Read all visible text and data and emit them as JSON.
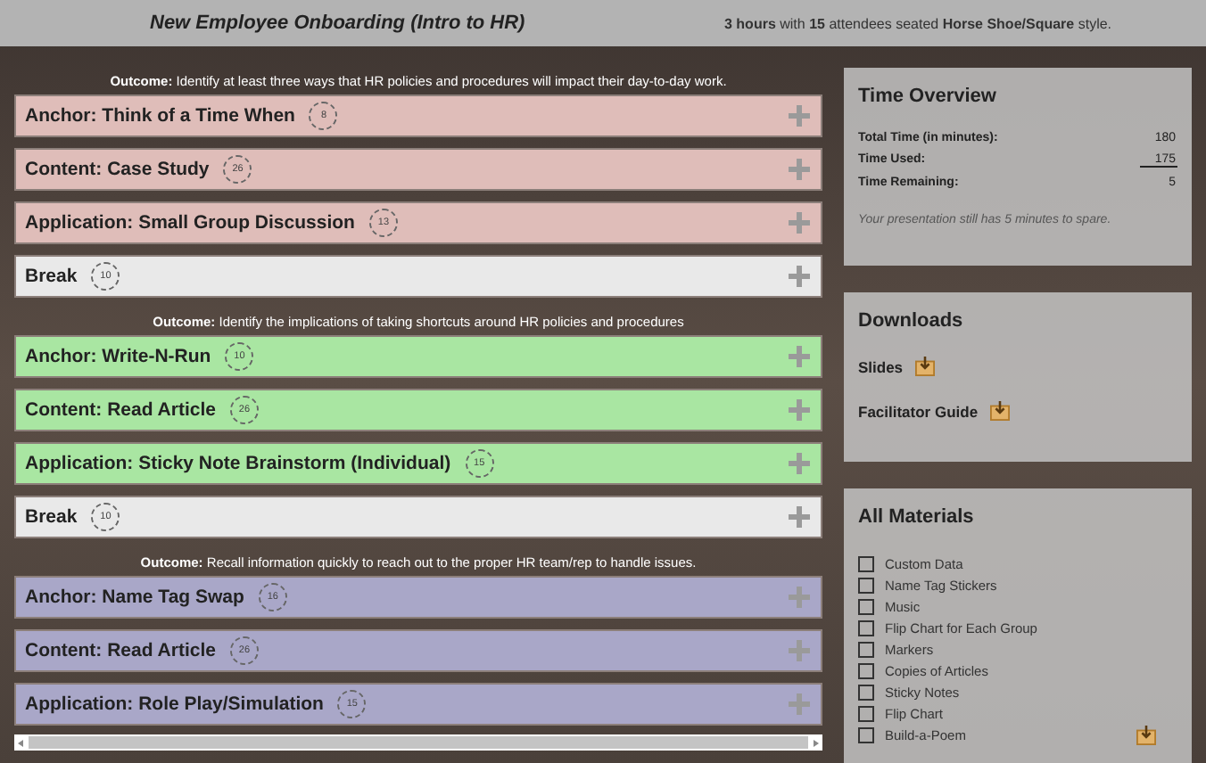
{
  "header": {
    "title": "New Employee Onboarding (Intro to HR)",
    "summary": "**3 hours** with **15** attendees seated **Horse Shoe/Square** style."
  },
  "agenda": [
    {
      "kind": "outcome",
      "label": "Outcome:",
      "text": "Identify at least three ways that HR policies and procedures will impact their day-to-day work."
    },
    {
      "kind": "activity",
      "title": "Anchor: Think of a Time When",
      "minutes": "8",
      "color": "#dfbdb9"
    },
    {
      "kind": "activity",
      "title": "Content: Case Study",
      "minutes": "26",
      "color": "#dfbdb9"
    },
    {
      "kind": "activity",
      "title": "Application: Small Group Discussion",
      "minutes": "13",
      "color": "#dfbdb9"
    },
    {
      "kind": "activity",
      "title": "Break",
      "minutes": "10",
      "color": "#e9e9e9"
    },
    {
      "kind": "outcome",
      "label": "Outcome:",
      "text": "Identify the implications of taking shortcuts around HR policies and procedures"
    },
    {
      "kind": "activity",
      "title": "Anchor: Write-N-Run",
      "minutes": "10",
      "color": "#a9e6a2"
    },
    {
      "kind": "activity",
      "title": "Content: Read Article",
      "minutes": "26",
      "color": "#a9e6a2"
    },
    {
      "kind": "activity",
      "title": "Application: Sticky Note Brainstorm (Individual)",
      "minutes": "15",
      "color": "#a9e6a2"
    },
    {
      "kind": "activity",
      "title": "Break",
      "minutes": "10",
      "color": "#e9e9e9"
    },
    {
      "kind": "outcome",
      "label": "Outcome:",
      "text": "Recall information quickly to reach out to the proper HR team/rep to handle issues."
    },
    {
      "kind": "activity",
      "title": "Anchor: Name Tag Swap",
      "minutes": "16",
      "color": "#a9a7c8"
    },
    {
      "kind": "activity",
      "title": "Content: Read Article",
      "minutes": "26",
      "color": "#a9a7c8"
    },
    {
      "kind": "activity",
      "title": "Application: Role Play/Simulation",
      "minutes": "15",
      "color": "#a9a7c8"
    }
  ],
  "time_overview": {
    "title": "Time Overview",
    "rows": [
      {
        "label": "Total Time (in minutes):",
        "value": "180",
        "underlined": false
      },
      {
        "label": "Time Used:",
        "value": "175",
        "underlined": true
      },
      {
        "label": "Time Remaining:",
        "value": "5",
        "underlined": false
      }
    ],
    "note": "Your presentation still has 5 minutes to spare."
  },
  "downloads": {
    "title": "Downloads",
    "items": [
      "Slides",
      "Facilitator Guide"
    ]
  },
  "materials": {
    "title": "All Materials",
    "items": [
      {
        "label": "Custom Data",
        "checked": false,
        "download": false
      },
      {
        "label": "Name Tag Stickers",
        "checked": false,
        "download": false
      },
      {
        "label": "Music",
        "checked": false,
        "download": false
      },
      {
        "label": "Flip Chart for Each Group",
        "checked": false,
        "download": false
      },
      {
        "label": "Markers",
        "checked": false,
        "download": false
      },
      {
        "label": "Copies of Articles",
        "checked": false,
        "download": false
      },
      {
        "label": "Sticky Notes",
        "checked": false,
        "download": false
      },
      {
        "label": "Flip Chart",
        "checked": false,
        "download": false
      },
      {
        "label": "Build-a-Poem",
        "checked": false,
        "download": true
      }
    ]
  }
}
